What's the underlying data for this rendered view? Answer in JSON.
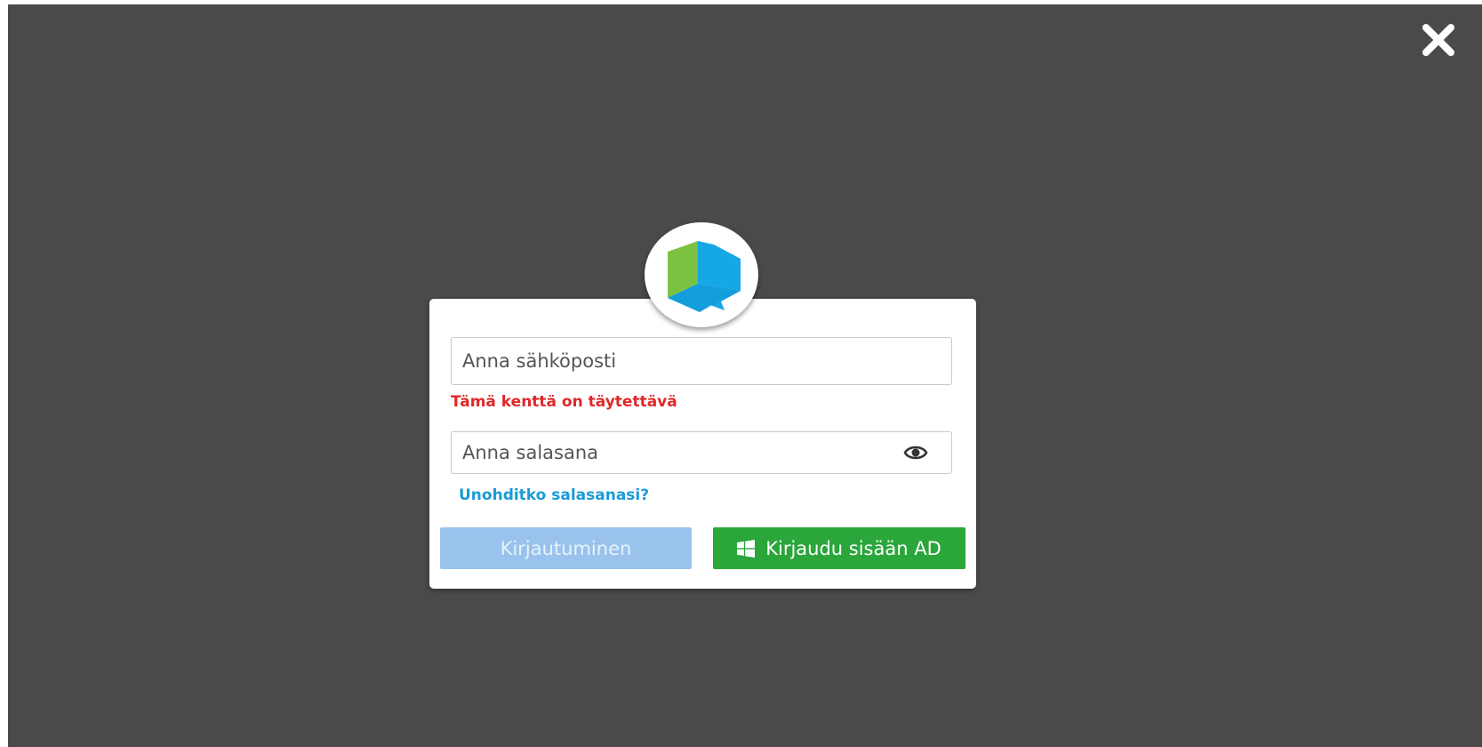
{
  "dialog": {
    "close_icon": "close-icon",
    "logo_icon": "cube-logo-icon",
    "email": {
      "placeholder": "Anna sähköposti",
      "value": ""
    },
    "email_error": "Tämä kenttä on täytettävä",
    "password": {
      "placeholder": "Anna salasana",
      "value": "",
      "toggle_icon": "eye-icon"
    },
    "forgot_password_label": "Unohditko salasanasi?",
    "login_button_label": "Kirjautuminen",
    "ad_login_button_label": "Kirjaudu sisään AD",
    "ad_button_icon": "windows-icon"
  },
  "colors": {
    "overlay": "#4a4a4a",
    "error": "#e02828",
    "link": "#1a9ad6",
    "login_button": "#99c3ed",
    "ad_button": "#2aa63a",
    "logo_green": "#7cc242",
    "logo_blue": "#16a7e6"
  }
}
